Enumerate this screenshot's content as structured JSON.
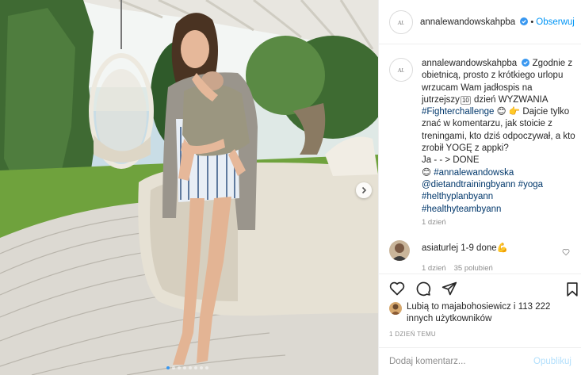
{
  "post": {
    "username": "annalewandowskahpba",
    "follow_label": "Obserwuj",
    "separator": "•",
    "caption": {
      "username": "annalewandowskahpba",
      "line1": "Zgodnie z obietnicą, prosto z krótkiego urlopu wrzucam Wam jadłospis na jutrzejszy",
      "day_number": "10",
      "line2": "dzień WYZWANIA",
      "hashtag_fighter": "#Fighterchallenge",
      "line3": "Dajcie tylko znać w komentarzu, jak stoicie z treningami, kto dziś odpoczywał, a kto zrobił YOGĘ z appki?",
      "line4": "Ja - - > DONE",
      "hashtag_anna": "#annalewandowska",
      "mention_diet": "@dietandtrainingbyann",
      "hashtag_yoga": "#yoga",
      "hashtag_healthy_plan": "#helthyplanbyann",
      "hashtag_healthy_team": "#healthyteambyann"
    },
    "caption_age": "1 dzień",
    "comment": {
      "username": "asiaturlej",
      "text": "1-9 done",
      "age": "1 dzień",
      "likes": "35 polubień"
    },
    "likes_summary": {
      "prefix": "Lubią to",
      "user": "majabohosiewicz",
      "conjunction": "i",
      "count": "113 222 innych użytkowników"
    },
    "timestamp": "1 DZIEŃ TEMU",
    "add_comment_placeholder": "Dodaj komentarz...",
    "publish_label": "Opublikuj",
    "carousel": {
      "dots": 8,
      "active_index": 0
    }
  },
  "icons": {
    "verified": "verified-badge-icon",
    "heart": "heart-icon",
    "comment": "comment-icon",
    "share": "share-icon",
    "save": "bookmark-icon",
    "next": "chevron-right-icon"
  },
  "colors": {
    "link_blue": "#0095f6",
    "hashtag": "#00376b",
    "muted": "#8e8e8e",
    "border": "#efefef",
    "verified": "#3897f0",
    "publish_disabled": "#b2dffc"
  }
}
